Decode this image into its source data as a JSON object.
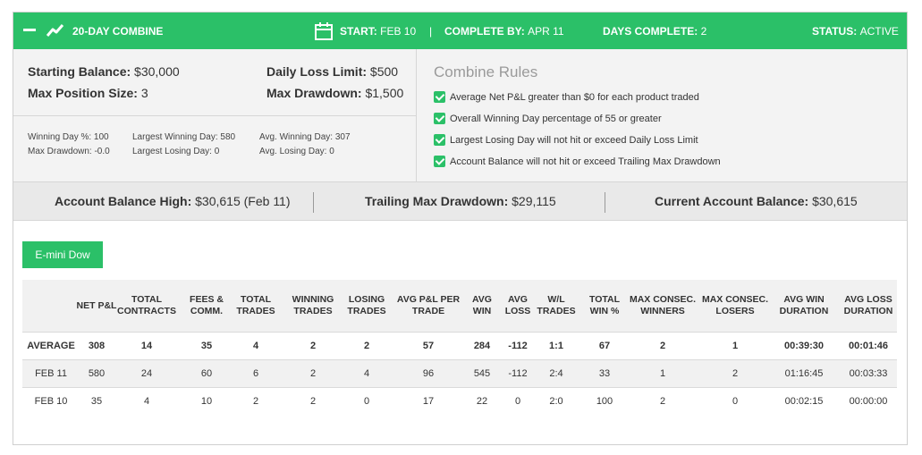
{
  "header": {
    "title": "20-DAY COMBINE",
    "start_label": "START:",
    "start_value": "FEB 10",
    "divider": "|",
    "complete_label": "COMPLETE BY:",
    "complete_value": "APR 11",
    "days_label": "DAYS COMPLETE:",
    "days_value": "2",
    "status_label": "STATUS:",
    "status_value": "ACTIVE",
    "accent_color": "#2bc068"
  },
  "summary": {
    "starting_balance_label": "Starting Balance:",
    "starting_balance_value": "$30,000",
    "daily_loss_label": "Daily Loss Limit:",
    "daily_loss_value": "$500",
    "max_position_label": "Max Position Size:",
    "max_position_value": "3",
    "max_drawdown_label": "Max Drawdown:",
    "max_drawdown_value": "$1,500"
  },
  "stats": {
    "winning_day_pct": "Winning Day %: 100",
    "max_drawdown": "Max Drawdown: -0.0",
    "largest_winning_day": "Largest Winning Day: 580",
    "largest_losing_day": "Largest Losing Day: 0",
    "avg_winning_day": "Avg. Winning Day: 307",
    "avg_losing_day": "Avg. Losing Day: 0"
  },
  "rules": {
    "title": "Combine Rules",
    "items": [
      "Average Net P&L greater than $0 for each product traded",
      "Overall Winning Day percentage of 55 or greater",
      "Largest Losing Day will not hit or exceed Daily Loss Limit",
      "Account Balance will not hit or exceed Trailing Max Drawdown"
    ]
  },
  "balances": {
    "high_label": "Account Balance High:",
    "high_value": "$30,615 (Feb 11)",
    "trailing_label": "Trailing Max Drawdown:",
    "trailing_value": "$29,115",
    "current_label": "Current Account Balance:",
    "current_value": "$30,615"
  },
  "product_tab": "E-mini Dow",
  "table": {
    "columns": [
      "",
      "NET P&L",
      "TOTAL CONTRACTS",
      "FEES & COMM.",
      "TOTAL TRADES",
      "WINNING TRADES",
      "LOSING TRADES",
      "AVG P&L PER TRADE",
      "AVG WIN",
      "AVG LOSS",
      "W/L TRADES",
      "TOTAL WIN %",
      "MAX CONSEC. WINNERS",
      "MAX CONSEC. LOSERS",
      "AVG WIN DURATION",
      "AVG LOSS DURATION"
    ],
    "rows": [
      [
        "AVERAGE",
        "308",
        "14",
        "35",
        "4",
        "2",
        "2",
        "57",
        "284",
        "-112",
        "1:1",
        "67",
        "2",
        "1",
        "00:39:30",
        "00:01:46"
      ],
      [
        "FEB 11",
        "580",
        "24",
        "60",
        "6",
        "2",
        "4",
        "96",
        "545",
        "-112",
        "2:4",
        "33",
        "1",
        "2",
        "01:16:45",
        "00:03:33"
      ],
      [
        "FEB 10",
        "35",
        "4",
        "10",
        "2",
        "2",
        "0",
        "17",
        "22",
        "0",
        "2:0",
        "100",
        "2",
        "0",
        "00:02:15",
        "00:00:00"
      ]
    ]
  }
}
